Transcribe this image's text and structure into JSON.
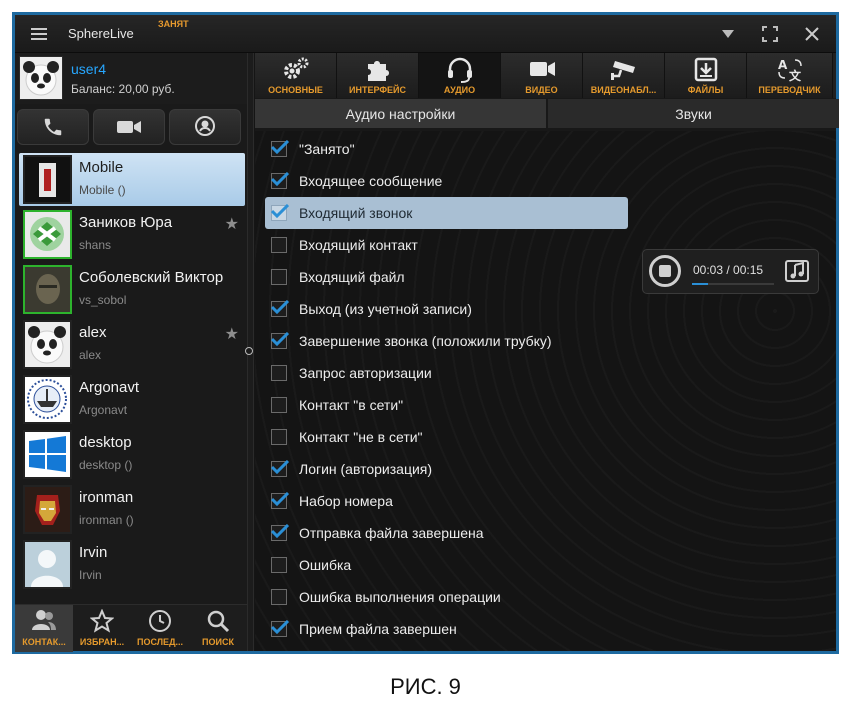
{
  "window": {
    "title": "SphereLive",
    "status": "ЗАНЯТ"
  },
  "user": {
    "name": "user4",
    "balance": "Баланс: 20,00 руб."
  },
  "contacts": [
    {
      "name": "Mobile",
      "sub": "Mobile ()",
      "selected": true,
      "online": false,
      "star": false
    },
    {
      "name": "Заников Юра",
      "sub": "shans",
      "selected": false,
      "online": true,
      "star": true
    },
    {
      "name": "Соболевский Виктор",
      "sub": "vs_sobol",
      "selected": false,
      "online": true,
      "star": false
    },
    {
      "name": "alex",
      "sub": "alex",
      "selected": false,
      "online": false,
      "star": true
    },
    {
      "name": "Argonavt",
      "sub": "Argonavt",
      "selected": false,
      "online": false,
      "star": false
    },
    {
      "name": "desktop",
      "sub": "desktop ()",
      "selected": false,
      "online": false,
      "star": false
    },
    {
      "name": "ironman",
      "sub": "ironman ()",
      "selected": false,
      "online": false,
      "star": false
    },
    {
      "name": "Irvin",
      "sub": "Irvin",
      "selected": false,
      "online": false,
      "star": false
    }
  ],
  "left_nav": [
    {
      "label": "КОНТАК...",
      "icon": "contacts-icon"
    },
    {
      "label": "ИЗБРАН...",
      "icon": "star-icon"
    },
    {
      "label": "ПОСЛЕД...",
      "icon": "clock-icon"
    },
    {
      "label": "ПОИСК",
      "icon": "search-icon"
    }
  ],
  "tabs": [
    {
      "label": "ОСНОВНЫЕ",
      "icon": "gears-icon"
    },
    {
      "label": "ИНТЕРФЕЙС",
      "icon": "puzzle-icon"
    },
    {
      "label": "АУДИО",
      "icon": "headset-icon"
    },
    {
      "label": "ВИДЕО",
      "icon": "camera-icon"
    },
    {
      "label": "ВИДЕОНАБЛ...",
      "icon": "cctv-icon"
    },
    {
      "label": "ФАЙЛЫ",
      "icon": "download-icon"
    },
    {
      "label": "ПЕРЕВОДЧИК",
      "icon": "translate-icon"
    }
  ],
  "active_tab": "АУДИО",
  "subtabs": [
    "Аудио настройки",
    "Звуки"
  ],
  "sounds": [
    {
      "label": "\"Занято\"",
      "checked": true
    },
    {
      "label": "Входящее сообщение",
      "checked": true
    },
    {
      "label": "Входящий звонок",
      "checked": true,
      "highlighted": true
    },
    {
      "label": "Входящий контакт",
      "checked": false
    },
    {
      "label": "Входящий файл",
      "checked": false
    },
    {
      "label": "Выход (из учетной записи)",
      "checked": true
    },
    {
      "label": "Завершение звонка (положили трубку)",
      "checked": true
    },
    {
      "label": "Запрос авторизации",
      "checked": false
    },
    {
      "label": "Контакт \"в сети\"",
      "checked": false
    },
    {
      "label": "Контакт \"не в сети\"",
      "checked": false
    },
    {
      "label": "Логин (авторизация)",
      "checked": true
    },
    {
      "label": "Набор номера",
      "checked": true
    },
    {
      "label": "Отправка файла завершена",
      "checked": true
    },
    {
      "label": "Ошибка",
      "checked": false
    },
    {
      "label": "Ошибка выполнения операции",
      "checked": false
    },
    {
      "label": "Прием файла завершен",
      "checked": true
    }
  ],
  "player": {
    "time": "00:03 / 00:15",
    "progress": 0.2
  },
  "caption": "РИС. 9",
  "colors": {
    "accent": "#e59a2d",
    "link": "#27a7ff",
    "check": "#2a8fd6",
    "online": "#2db32d",
    "frame": "#1e6aa0"
  }
}
